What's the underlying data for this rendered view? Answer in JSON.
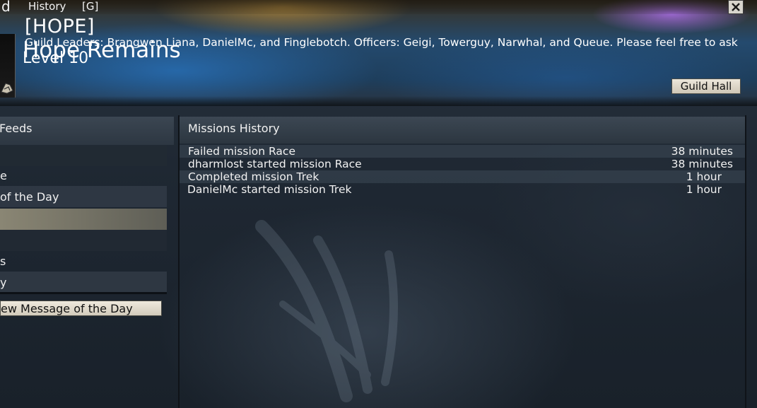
{
  "window": {
    "tab_label": "History",
    "hotkey": "[G]",
    "left_glyph": "d",
    "close_icon": "close-icon"
  },
  "guild": {
    "tag": "[HOPE]",
    "name": "Hope Remains",
    "level": "Level 10",
    "motd": "Guild Leaders: Brangwen Liana, DanielMc, and Finglebotch.  Officers: Geigi, Towerguy, Narwhal, and Queue. Please feel free to ask",
    "guild_hall_label": "Guild Hall"
  },
  "left_panel": {
    "title": "Feeds",
    "rows": [
      {
        "label": ""
      },
      {
        "label": "e"
      },
      {
        "label": " of the Day"
      },
      {
        "label": ""
      },
      {
        "label": ""
      },
      {
        "label": "s"
      },
      {
        "label": "y"
      }
    ],
    "motd_button_label": "ew Message of the Day"
  },
  "missions": {
    "title": "Missions History",
    "entries": [
      {
        "text": "Failed mission Race",
        "time": "38 minutes"
      },
      {
        "text": "dharmlost started mission Race",
        "time": "38 minutes"
      },
      {
        "text": "Completed mission Trek",
        "time": "1 hour"
      },
      {
        "text": "DanielMc started mission Trek",
        "time": "1 hour"
      }
    ]
  },
  "colors": {
    "background": "#1c2530",
    "header_blue": "#244a6e",
    "button_face": "#e0d9cb"
  }
}
